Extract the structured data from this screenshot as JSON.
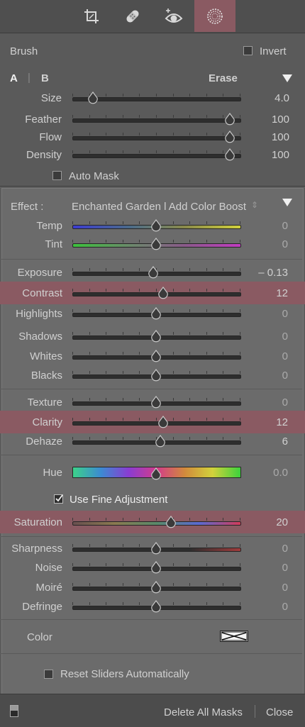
{
  "toolbar": {
    "tools": [
      "crop-icon",
      "healing-icon",
      "redeye-icon",
      "mask-brush-icon"
    ],
    "active": "mask-brush-icon",
    "accent": "#8a5a62"
  },
  "brush": {
    "title": "Brush",
    "invert_label": "Invert",
    "tab_a": "A",
    "tab_divider": "|",
    "tab_b": "B",
    "erase_label": "Erase",
    "size": {
      "label": "Size",
      "value": "4.0",
      "fraction": 0.07
    },
    "feather": {
      "label": "Feather",
      "value": "100",
      "fraction": 1.0
    },
    "flow": {
      "label": "Flow",
      "value": "100",
      "fraction": 1.0
    },
    "density": {
      "label": "Density",
      "value": "100",
      "fraction": 1.0
    },
    "auto_mask_label": "Auto Mask"
  },
  "effect": {
    "label": "Effect :",
    "preset": "Enchanted Garden l Add Color Boost",
    "temp": {
      "label": "Temp",
      "value": "0",
      "fraction": 0.5
    },
    "tint": {
      "label": "Tint",
      "value": "0",
      "fraction": 0.5
    },
    "exposure": {
      "label": "Exposure",
      "value": "– 0.13",
      "fraction": 0.48
    },
    "contrast": {
      "label": "Contrast",
      "value": "12",
      "fraction": 0.55
    },
    "highlights": {
      "label": "Highlights",
      "value": "0",
      "fraction": 0.5
    },
    "shadows": {
      "label": "Shadows",
      "value": "0",
      "fraction": 0.5
    },
    "whites": {
      "label": "Whites",
      "value": "0",
      "fraction": 0.5
    },
    "blacks": {
      "label": "Blacks",
      "value": "0",
      "fraction": 0.5
    },
    "texture": {
      "label": "Texture",
      "value": "0",
      "fraction": 0.5
    },
    "clarity": {
      "label": "Clarity",
      "value": "12",
      "fraction": 0.55
    },
    "dehaze": {
      "label": "Dehaze",
      "value": "6",
      "fraction": 0.53
    },
    "hue": {
      "label": "Hue",
      "value": "0.0",
      "fraction": 0.5
    },
    "fine_adjust_label": "Use Fine Adjustment",
    "saturation": {
      "label": "Saturation",
      "value": "20",
      "fraction": 0.6
    },
    "sharpness": {
      "label": "Sharpness",
      "value": "0",
      "fraction": 0.5
    },
    "noise": {
      "label": "Noise",
      "value": "0",
      "fraction": 0.5
    },
    "moire": {
      "label": "Moiré",
      "value": "0",
      "fraction": 0.5
    },
    "defringe": {
      "label": "Defringe",
      "value": "0",
      "fraction": 0.5
    },
    "color_label": "Color",
    "reset_label": "Reset Sliders Automatically"
  },
  "footer": {
    "delete_label": "Delete All Masks",
    "close_label": "Close"
  }
}
